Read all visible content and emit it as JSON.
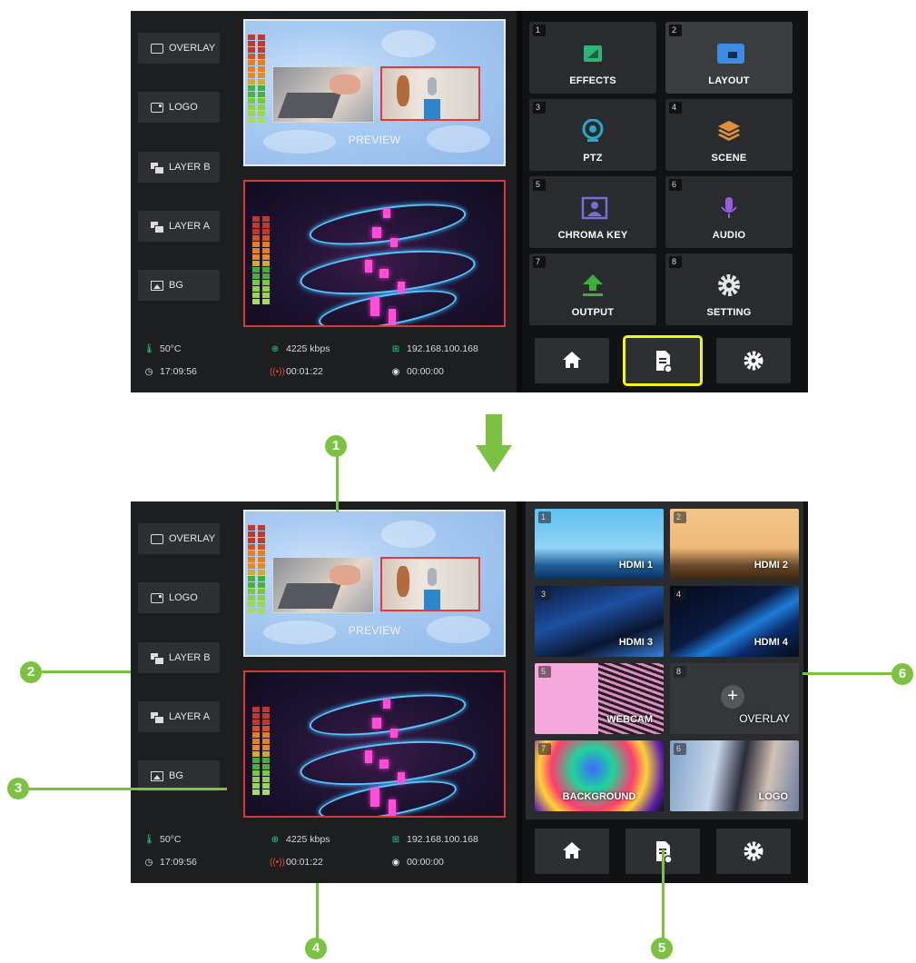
{
  "sidebar": {
    "items": [
      {
        "label": "OVERLAY",
        "icon": "overlay-icon"
      },
      {
        "label": "LOGO",
        "icon": "logo-icon"
      },
      {
        "label": "LAYER B",
        "icon": "layer-b-icon"
      },
      {
        "label": "LAYER A",
        "icon": "layer-a-icon"
      },
      {
        "label": "BG",
        "icon": "image-icon"
      }
    ]
  },
  "preview": {
    "label": "PREVIEW"
  },
  "status": {
    "temperature": "50°C",
    "clock": "17:09:56",
    "bitrate": "4225 kbps",
    "stream_time": "00:01:22",
    "ip": "192.168.100.168",
    "record_time": "00:00:00"
  },
  "function_tiles": [
    {
      "number": "1",
      "label": "EFFECTS",
      "icon": "effects-icon",
      "color": "#2bb673"
    },
    {
      "number": "2",
      "label": "LAYOUT",
      "icon": "layout-icon",
      "color": "#3d8be3"
    },
    {
      "number": "3",
      "label": "PTZ",
      "icon": "ptz-camera-icon",
      "color": "#2aa8c9"
    },
    {
      "number": "4",
      "label": "SCENE",
      "icon": "scene-layers-icon",
      "color": "#e0913a"
    },
    {
      "number": "5",
      "label": "CHROMA KEY",
      "icon": "chroma-key-icon",
      "color": "#7b6cd9"
    },
    {
      "number": "6",
      "label": "AUDIO",
      "icon": "microphone-icon",
      "color": "#9b5ce0"
    },
    {
      "number": "7",
      "label": "OUTPUT",
      "icon": "upload-icon",
      "color": "#3fae3f"
    },
    {
      "number": "8",
      "label": "SETTING",
      "icon": "gear-icon",
      "color": "#e6e6e6"
    }
  ],
  "nav": {
    "home_icon": "home-icon",
    "source_icon": "document-icon",
    "settings_icon": "gear-icon"
  },
  "sources": [
    {
      "number": "1",
      "label": "HDMI 1"
    },
    {
      "number": "2",
      "label": "HDMI 2"
    },
    {
      "number": "3",
      "label": "HDMI 3"
    },
    {
      "number": "4",
      "label": "HDMI 4"
    },
    {
      "number": "5",
      "label": "WEBCAM"
    },
    {
      "number": "8",
      "label": "OVERLAY",
      "plus": "+"
    },
    {
      "number": "7",
      "label": "BACKGROUND"
    },
    {
      "number": "6",
      "label": "LOGO"
    }
  ],
  "callouts": [
    "1",
    "2",
    "3",
    "4",
    "5",
    "6"
  ],
  "colors": {
    "highlight": "#f7f51b",
    "callout": "#7cc242",
    "program_border": "#d9373a"
  }
}
